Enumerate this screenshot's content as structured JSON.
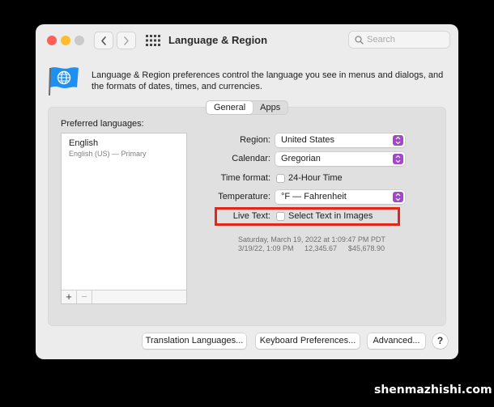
{
  "window": {
    "title": "Language & Region",
    "search_placeholder": "Search"
  },
  "description": "Language & Region preferences control the language you see in menus and dialogs, and the formats of dates, times, and currencies.",
  "tabs": [
    {
      "label": "General",
      "active": true
    },
    {
      "label": "Apps",
      "active": false
    }
  ],
  "languages": {
    "header": "Preferred languages:",
    "items": [
      {
        "name": "English",
        "subtitle": "English (US) — Primary"
      }
    ],
    "add_label": "+",
    "remove_label": "−"
  },
  "settings": {
    "region": {
      "label": "Region:",
      "value": "United States"
    },
    "calendar": {
      "label": "Calendar:",
      "value": "Gregorian"
    },
    "time_format": {
      "label": "Time format:",
      "checkbox_label": "24-Hour Time",
      "checked": false
    },
    "temperature": {
      "label": "Temperature:",
      "value": "°F — Fahrenheit"
    },
    "live_text": {
      "label": "Live Text:",
      "checkbox_label": "Select Text in Images",
      "checked": false
    }
  },
  "preview": {
    "long_date": "Saturday, March 19, 2022 at 1:09:47 PM PDT",
    "short_date": "3/19/22, 1:09 PM",
    "number": "12,345.67",
    "currency": "$45,678.90"
  },
  "buttons": {
    "translation": "Translation Languages...",
    "keyboard": "Keyboard Preferences...",
    "advanced": "Advanced...",
    "help": "?"
  },
  "watermark": "shenmazhishi.com",
  "colors": {
    "accent": "#a347c9",
    "highlight_box": "#e2261a",
    "close": "#fe5f57",
    "minimize": "#febc2e"
  }
}
